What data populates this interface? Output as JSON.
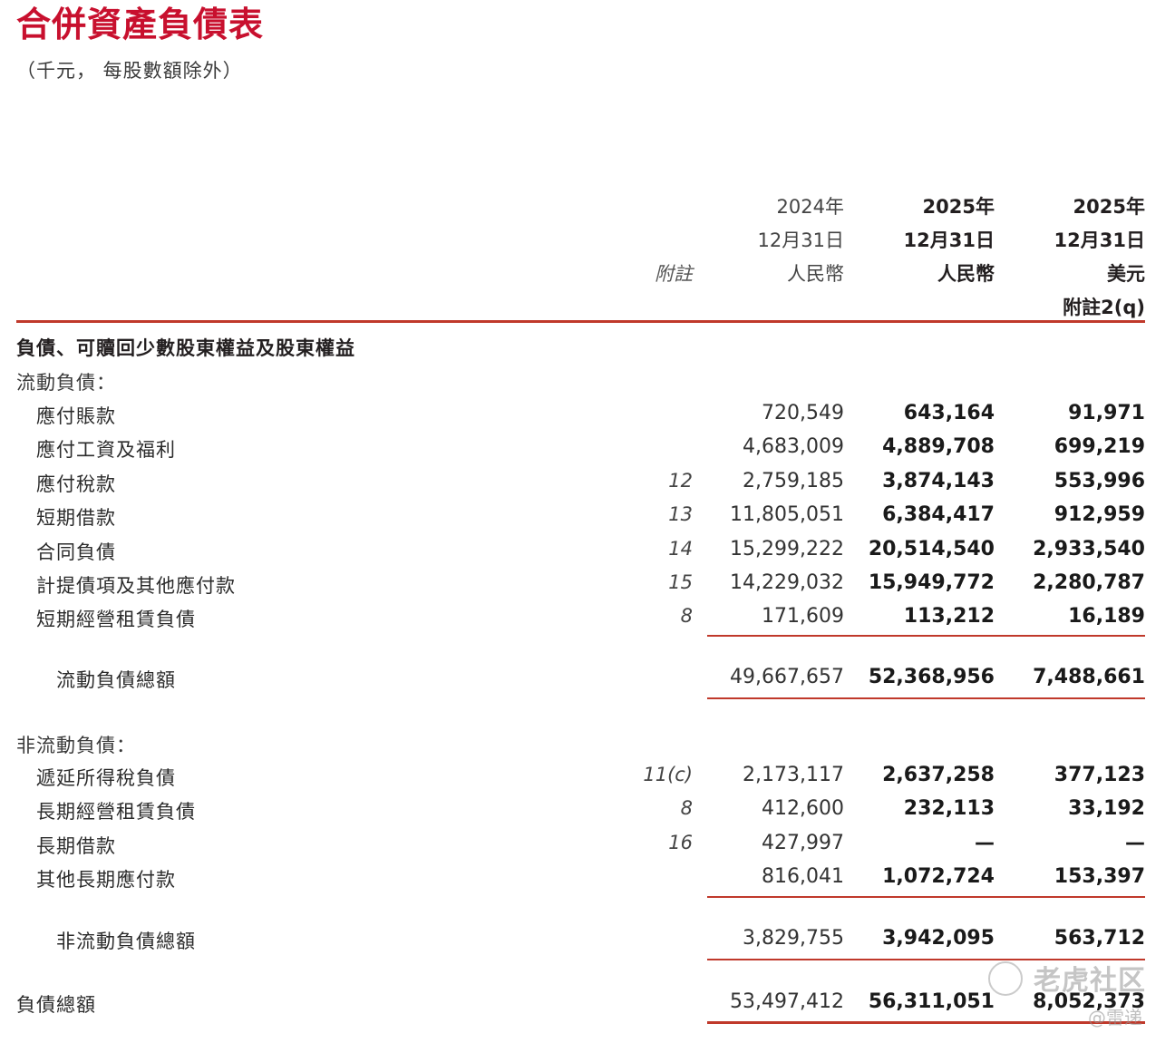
{
  "title": "合併資產負債表",
  "subtitle": "（千元，  每股數額除外）",
  "header": {
    "note_label": "附註",
    "col1": {
      "year": "2024年",
      "date": "12月31日",
      "currency": "人民幣"
    },
    "col2": {
      "year": "2025年",
      "date": "12月31日",
      "currency": "人民幣"
    },
    "col3": {
      "year": "2025年",
      "date": "12月31日",
      "currency": "美元",
      "note": "附註2(q)"
    }
  },
  "section_title": "負債、可贖回少數股東權益及股東權益",
  "current": {
    "heading": "流動負債：",
    "rows": [
      {
        "label": "應付賬款",
        "note": "",
        "v1": "720,549",
        "v2": "643,164",
        "v3": "91,971"
      },
      {
        "label": "應付工資及福利",
        "note": "",
        "v1": "4,683,009",
        "v2": "4,889,708",
        "v3": "699,219"
      },
      {
        "label": "應付稅款",
        "note": "12",
        "v1": "2,759,185",
        "v2": "3,874,143",
        "v3": "553,996"
      },
      {
        "label": "短期借款",
        "note": "13",
        "v1": "11,805,051",
        "v2": "6,384,417",
        "v3": "912,959"
      },
      {
        "label": "合同負債",
        "note": "14",
        "v1": "15,299,222",
        "v2": "20,514,540",
        "v3": "2,933,540"
      },
      {
        "label": "計提債項及其他應付款",
        "note": "15",
        "v1": "14,229,032",
        "v2": "15,949,772",
        "v3": "2,280,787"
      },
      {
        "label": "短期經營租賃負債",
        "note": "8",
        "v1": "171,609",
        "v2": "113,212",
        "v3": "16,189"
      }
    ],
    "total": {
      "label": "流動負債總額",
      "v1": "49,667,657",
      "v2": "52,368,956",
      "v3": "7,488,661"
    }
  },
  "noncurrent": {
    "heading": "非流動負債：",
    "rows": [
      {
        "label": "遞延所得稅負債",
        "note": "11(c)",
        "v1": "2,173,117",
        "v2": "2,637,258",
        "v3": "377,123"
      },
      {
        "label": "長期經營租賃負債",
        "note": "8",
        "v1": "412,600",
        "v2": "232,113",
        "v3": "33,192"
      },
      {
        "label": "長期借款",
        "note": "16",
        "v1": "427,997",
        "v2": "—",
        "v3": "—"
      },
      {
        "label": "其他長期應付款",
        "note": "",
        "v1": "816,041",
        "v2": "1,072,724",
        "v3": "153,397"
      }
    ],
    "total": {
      "label": "非流動負債總額",
      "v1": "3,829,755",
      "v2": "3,942,095",
      "v3": "563,712"
    }
  },
  "grand_total": {
    "label": "負債總額",
    "v1": "53,497,412",
    "v2": "56,311,051",
    "v3": "8,052,373"
  },
  "watermark": {
    "text": "老虎社区",
    "handle": "@雷递"
  },
  "colors": {
    "accent": "#c8102e",
    "rule": "#c0392b"
  }
}
